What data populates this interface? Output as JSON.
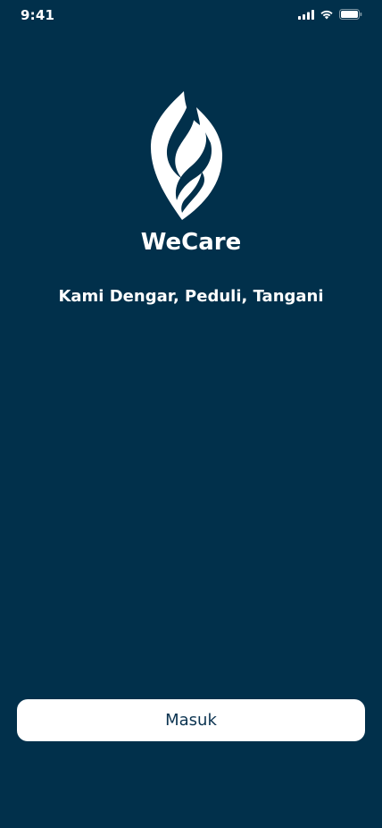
{
  "status_bar": {
    "time": "9:41"
  },
  "app": {
    "name": "WeCare",
    "tagline": "Kami Dengar, Peduli, Tangani"
  },
  "actions": {
    "login_label": "Masuk"
  },
  "colors": {
    "background": "#01304b",
    "button_bg": "#ffffff",
    "button_text": "#0b3350"
  },
  "icons": [
    "signal-icon",
    "wifi-icon",
    "battery-icon",
    "wecare-logo-icon"
  ]
}
